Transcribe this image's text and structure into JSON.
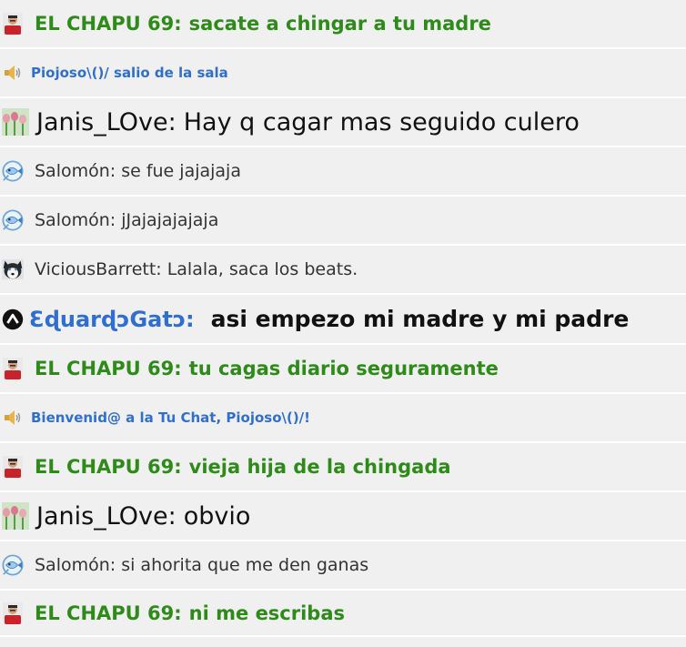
{
  "messages": [
    {
      "style": "green",
      "icon": "user-avatar-red-shirt-icon",
      "name": "EL CHAPU 69",
      "text": "sacate a chingar a tu madre"
    },
    {
      "style": "sys",
      "icon": "speaker-icon",
      "name": "",
      "text": "Piojoso\\()/ salio de la sala"
    },
    {
      "style": "large",
      "icon": "tulips-avatar-icon",
      "name": "Janis_LOve",
      "text": "Hay q cagar mas seguido culero"
    },
    {
      "style": "small",
      "icon": "fish-avatar-icon",
      "name": "Salomón",
      "text": "se fue jajajaja"
    },
    {
      "style": "small",
      "icon": "fish-avatar-icon",
      "name": "Salomón",
      "text": "jJajajajajaja"
    },
    {
      "style": "small",
      "icon": "husky-avatar-icon",
      "name": "ViciousBarrett",
      "text": "Lalala, saca los beats."
    },
    {
      "style": "blue",
      "icon": "arrow-up-circle-icon",
      "name": "ƐɖuarɖɔGatɔ",
      "text": "asi empezo mi madre y mi padre"
    },
    {
      "style": "green",
      "icon": "user-avatar-red-shirt-icon",
      "name": "EL CHAPU 69",
      "text": "tu cagas diario seguramente"
    },
    {
      "style": "sys",
      "icon": "speaker-icon",
      "name": "",
      "text": "Bienvenid@ a la Tu Chat, Piojoso\\()/!"
    },
    {
      "style": "green",
      "icon": "user-avatar-red-shirt-icon",
      "name": "EL CHAPU 69",
      "text": "vieja hija de la chingada"
    },
    {
      "style": "large",
      "icon": "tulips-avatar-icon",
      "name": "Janis_LOve",
      "text": "obvio"
    },
    {
      "style": "small",
      "icon": "fish-avatar-icon",
      "name": "Salomón",
      "text": "si ahorita que me den ganas"
    },
    {
      "style": "green",
      "icon": "user-avatar-red-shirt-icon",
      "name": "EL CHAPU 69",
      "text": "ni me escribas"
    }
  ],
  "colors": {
    "green": "#2e8b1a",
    "system_blue": "#2f6fd0",
    "background": "#f0f0f0",
    "divider": "#ffffff"
  }
}
